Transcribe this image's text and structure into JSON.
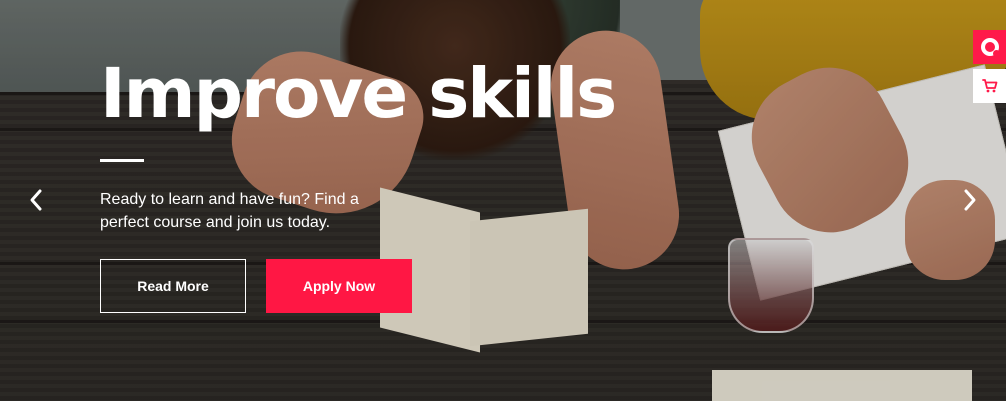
{
  "hero": {
    "title": "Improve skills",
    "subtitle": "Ready to learn and have fun? Find a perfect course and join us today.",
    "read_more_label": "Read More",
    "apply_now_label": "Apply Now"
  },
  "navigation": {
    "prev_icon": "chevron-left-icon",
    "next_icon": "chevron-right-icon"
  },
  "side_toolbar": {
    "items": [
      {
        "icon": "ring-icon"
      },
      {
        "icon": "shopping-cart-icon"
      }
    ]
  },
  "colors": {
    "accent": "#ff1744",
    "text": "#ffffff"
  }
}
